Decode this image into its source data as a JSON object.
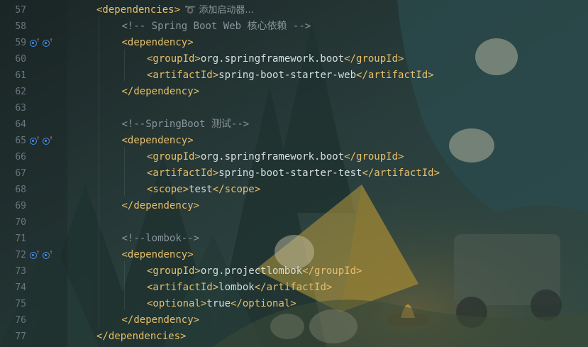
{
  "editor": {
    "lines": [
      {
        "num": "57",
        "indent": 0,
        "parts": [
          {
            "t": "tag",
            "v": "<dependencies>"
          }
        ],
        "hint": "添加启动器...",
        "icons": false
      },
      {
        "num": "58",
        "indent": 1,
        "parts": [
          {
            "t": "cmt",
            "v": "<!-- Spring Boot Web 核心依赖 -->"
          }
        ],
        "icons": false
      },
      {
        "num": "59",
        "indent": 1,
        "parts": [
          {
            "t": "tag",
            "v": "<dependency>"
          }
        ],
        "icons": true
      },
      {
        "num": "60",
        "indent": 2,
        "parts": [
          {
            "t": "tag",
            "v": "<groupId>"
          },
          {
            "t": "txt",
            "v": "org.springframework.boot"
          },
          {
            "t": "tag",
            "v": "</groupId>"
          }
        ],
        "icons": false
      },
      {
        "num": "61",
        "indent": 2,
        "parts": [
          {
            "t": "tag",
            "v": "<artifactId>"
          },
          {
            "t": "txt",
            "v": "spring-boot-starter-web"
          },
          {
            "t": "tag",
            "v": "</artifactId>"
          }
        ],
        "icons": false
      },
      {
        "num": "62",
        "indent": 1,
        "parts": [
          {
            "t": "tag",
            "v": "</dependency>"
          }
        ],
        "icons": false
      },
      {
        "num": "63",
        "indent": 0,
        "parts": [],
        "icons": false
      },
      {
        "num": "64",
        "indent": 1,
        "parts": [
          {
            "t": "cmt",
            "v": "<!--SpringBoot 测试-->"
          }
        ],
        "icons": false
      },
      {
        "num": "65",
        "indent": 1,
        "parts": [
          {
            "t": "tag",
            "v": "<dependency>"
          }
        ],
        "icons": true
      },
      {
        "num": "66",
        "indent": 2,
        "parts": [
          {
            "t": "tag",
            "v": "<groupId>"
          },
          {
            "t": "txt",
            "v": "org.springframework.boot"
          },
          {
            "t": "tag",
            "v": "</groupId>"
          }
        ],
        "icons": false
      },
      {
        "num": "67",
        "indent": 2,
        "parts": [
          {
            "t": "tag",
            "v": "<artifactId>"
          },
          {
            "t": "txt",
            "v": "spring-boot-starter-test"
          },
          {
            "t": "tag",
            "v": "</artifactId>"
          }
        ],
        "icons": false
      },
      {
        "num": "68",
        "indent": 2,
        "parts": [
          {
            "t": "tag",
            "v": "<scope>"
          },
          {
            "t": "txt",
            "v": "test"
          },
          {
            "t": "tag",
            "v": "</scope>"
          }
        ],
        "icons": false
      },
      {
        "num": "69",
        "indent": 1,
        "parts": [
          {
            "t": "tag",
            "v": "</dependency>"
          }
        ],
        "icons": false
      },
      {
        "num": "70",
        "indent": 0,
        "parts": [],
        "icons": false
      },
      {
        "num": "71",
        "indent": 1,
        "parts": [
          {
            "t": "cmt",
            "v": "<!--lombok-->"
          }
        ],
        "icons": false
      },
      {
        "num": "72",
        "indent": 1,
        "parts": [
          {
            "t": "tag",
            "v": "<dependency>"
          }
        ],
        "icons": true
      },
      {
        "num": "73",
        "indent": 2,
        "parts": [
          {
            "t": "tag",
            "v": "<groupId>"
          },
          {
            "t": "txt",
            "v": "org.projectlombok"
          },
          {
            "t": "tag",
            "v": "</groupId>"
          }
        ],
        "icons": false
      },
      {
        "num": "74",
        "indent": 2,
        "parts": [
          {
            "t": "tag",
            "v": "<artifactId>"
          },
          {
            "t": "txt",
            "v": "lombok"
          },
          {
            "t": "tag",
            "v": "</artifactId>"
          }
        ],
        "icons": false
      },
      {
        "num": "75",
        "indent": 2,
        "parts": [
          {
            "t": "tag",
            "v": "<optional>"
          },
          {
            "t": "txt",
            "v": "true"
          },
          {
            "t": "tag",
            "v": "</optional>"
          }
        ],
        "icons": false
      },
      {
        "num": "76",
        "indent": 1,
        "parts": [
          {
            "t": "tag",
            "v": "</dependency>"
          }
        ],
        "icons": false
      },
      {
        "num": "77",
        "indent": 0,
        "parts": [
          {
            "t": "tag",
            "v": "</dependencies>"
          }
        ],
        "icons": false
      }
    ]
  },
  "gutter_icons": [
    "maven-dependency-icon",
    "override-arrow-icon"
  ],
  "colors": {
    "tag": "#e8bf6a",
    "text": "#d6dde0",
    "comment": "#8a949c",
    "line_number": "#6b7680",
    "gutter_icon": "#4a8ee8"
  }
}
